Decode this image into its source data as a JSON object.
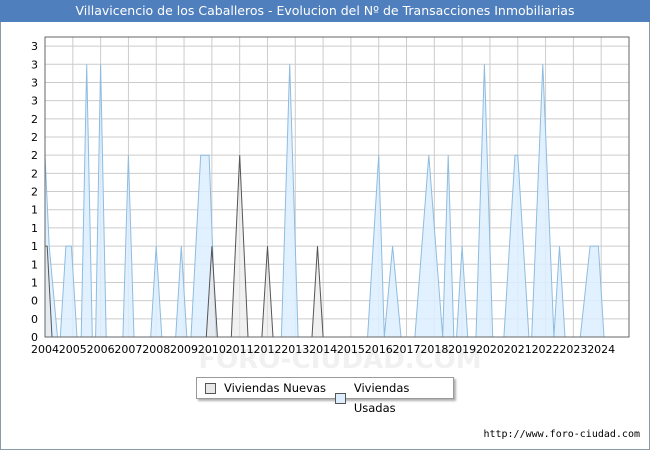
{
  "title": "Villavicencio de los Caballeros - Evolucion del Nº de Transacciones Inmobiliarias",
  "source": "http://www.foro-ciudad.com",
  "watermark": "FORO-CIUDAD.COM",
  "colors": {
    "header": "#4f7fbd",
    "usadas_fill": "#ddeeff",
    "usadas_line": "#8fbcdf",
    "nuevas_fill": "#e8e8e8",
    "nuevas_line": "#555555",
    "grid": "#cccccc"
  },
  "chart_data": {
    "type": "area",
    "title": "Villavicencio de los Caballeros - Evolucion del Nº de Transacciones Inmobiliarias",
    "xlabel": "",
    "ylabel": "",
    "xlim": [
      2004.0,
      2025.0
    ],
    "ylim": [
      0,
      3.3
    ],
    "grid": true,
    "legend_position": "bottom",
    "x_ticks": [
      "2004",
      "2005",
      "2006",
      "2007",
      "2008",
      "2009",
      "2010",
      "2011",
      "2012",
      "2013",
      "2014",
      "2015",
      "2016",
      "2017",
      "2018",
      "2019",
      "2020",
      "2021",
      "2022",
      "2023",
      "2024"
    ],
    "y_tick_values": [
      0,
      0.2,
      0.4,
      0.6,
      0.8,
      1.0,
      1.2,
      1.4,
      1.6,
      1.8,
      2.0,
      2.2,
      2.4,
      2.6,
      2.8,
      3.0,
      3.2
    ],
    "y_tick_labels": [
      "0",
      "0",
      "0",
      "1",
      "1",
      "1",
      "1",
      "1",
      "2",
      "2",
      "2",
      "2",
      "2",
      "3",
      "3",
      "3",
      "3"
    ],
    "series": [
      {
        "name": "Viviendas Nuevas",
        "points": [
          [
            2004.0,
            1.0
          ],
          [
            2004.08,
            1.0
          ],
          [
            2004.25,
            0
          ],
          [
            2009.8,
            0
          ],
          [
            2010.0,
            1.0
          ],
          [
            2010.2,
            0
          ],
          [
            2010.7,
            0
          ],
          [
            2011.0,
            2.0
          ],
          [
            2011.3,
            0
          ],
          [
            2011.8,
            0
          ],
          [
            2012.0,
            1.0
          ],
          [
            2012.2,
            0
          ],
          [
            2013.6,
            0
          ],
          [
            2013.8,
            1.0
          ],
          [
            2014.0,
            0
          ]
        ]
      },
      {
        "name": "Viviendas Usadas",
        "points": [
          [
            2004.0,
            2.0
          ],
          [
            2004.15,
            1.0
          ],
          [
            2004.45,
            0
          ],
          [
            2004.55,
            0
          ],
          [
            2004.75,
            1.0
          ],
          [
            2004.95,
            1.0
          ],
          [
            2005.15,
            0
          ],
          [
            2005.3,
            0
          ],
          [
            2005.5,
            3.0
          ],
          [
            2005.7,
            0
          ],
          [
            2005.82,
            0
          ],
          [
            2006.0,
            3.0
          ],
          [
            2006.2,
            0
          ],
          [
            2006.8,
            0
          ],
          [
            2007.0,
            2.0
          ],
          [
            2007.2,
            0
          ],
          [
            2007.8,
            0
          ],
          [
            2008.0,
            1.0
          ],
          [
            2008.2,
            0
          ],
          [
            2008.7,
            0
          ],
          [
            2008.9,
            1.0
          ],
          [
            2009.1,
            0
          ],
          [
            2009.25,
            0
          ],
          [
            2009.6,
            2.0
          ],
          [
            2009.9,
            2.0
          ],
          [
            2010.15,
            0
          ],
          [
            2012.5,
            0
          ],
          [
            2012.8,
            3.0
          ],
          [
            2013.1,
            0
          ],
          [
            2015.6,
            0
          ],
          [
            2016.0,
            2.0
          ],
          [
            2016.2,
            0
          ],
          [
            2016.2,
            0
          ],
          [
            2016.5,
            1.0
          ],
          [
            2016.8,
            0
          ],
          [
            2017.3,
            0
          ],
          [
            2017.8,
            2.0
          ],
          [
            2018.3,
            0
          ],
          [
            2018.3,
            0
          ],
          [
            2018.5,
            2.0
          ],
          [
            2018.7,
            0
          ],
          [
            2018.8,
            0
          ],
          [
            2019.0,
            1.0
          ],
          [
            2019.2,
            0
          ],
          [
            2019.5,
            0
          ],
          [
            2019.8,
            3.0
          ],
          [
            2020.1,
            0
          ],
          [
            2020.5,
            0
          ],
          [
            2020.9,
            2.0
          ],
          [
            2021.0,
            2.0
          ],
          [
            2021.4,
            0
          ],
          [
            2021.5,
            0
          ],
          [
            2021.9,
            3.0
          ],
          [
            2022.3,
            0
          ],
          [
            2022.3,
            0
          ],
          [
            2022.5,
            1.0
          ],
          [
            2022.7,
            0
          ],
          [
            2023.25,
            0
          ],
          [
            2023.6,
            1.0
          ],
          [
            2023.9,
            1.0
          ],
          [
            2024.1,
            0
          ]
        ]
      }
    ]
  },
  "legend": {
    "nuevas_label": "Viviendas Nuevas",
    "usadas_label": "Viviendas Usadas"
  }
}
